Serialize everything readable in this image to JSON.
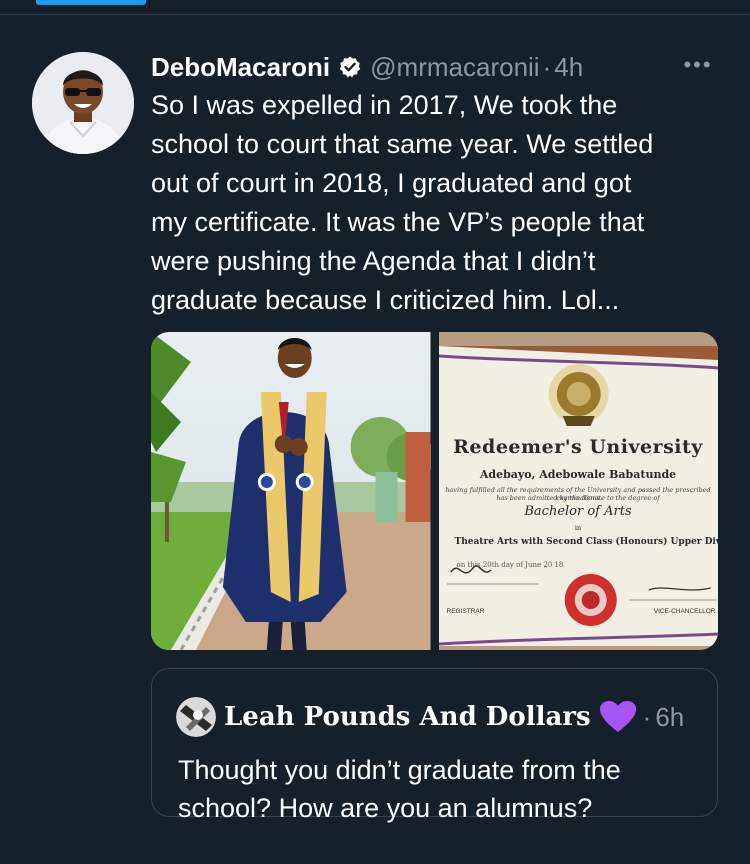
{
  "tweet": {
    "author_name": "DeboMacaroni",
    "handle": "@mrmacaronii",
    "separator": "·",
    "time": "4h",
    "more": "•••",
    "text": "So I was expelled in 2017, We took the\nschool to court that same year. We settled\nout of court in 2018, I graduated and got\nmy certificate. It was the VP’s people that\nwere pushing the Agenda that I didn’t\ngraduate because I criticized him. Lol..."
  },
  "certificate": {
    "school": "Redeemer's University",
    "recipient": "Adebayo, Adebowale Babatunde",
    "requirements": "having fulfilled all the requirements of the University and passed the prescribed examinations",
    "admitted": "has been admitted by the Senate to the degree of",
    "degree": "Bachelor of Arts",
    "in": "in",
    "program": "Theatre Arts with Second Class (Honours) Upper Division",
    "date_line": "on this      20th      day of            June                    20 18",
    "registrar": "REGISTRAR",
    "vice_chancellor": "VICE-CHANCELLOR"
  },
  "quoted": {
    "author_name": "Leah Pounds And Dollars",
    "separator": "·",
    "time": "6h",
    "text": "Thought you didn’t graduate from the school? How are you an alumnus?"
  },
  "colors": {
    "background": "#15202b",
    "secondary_text": "#8b98a5",
    "border": "#38444d",
    "accent": "#1d9bf0",
    "heart": "#a855f7"
  }
}
